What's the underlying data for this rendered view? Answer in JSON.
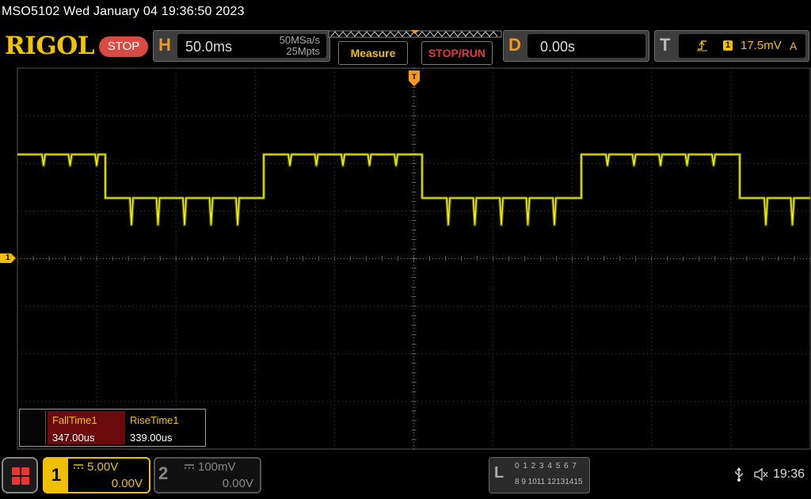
{
  "window": {
    "title": "MSO5102  Wed January 04 19:36:50 2023"
  },
  "header": {
    "logo": "RIGOL",
    "run_state": "STOP",
    "horizontal": {
      "letter": "H",
      "timebase": "50.0ms",
      "sample_rate": "50MSa/s",
      "memory_depth": "25Mpts"
    },
    "measure_label": "Measure",
    "stop_run_label": "STOP/RUN",
    "delay": {
      "letter": "D",
      "value": "0.00s"
    },
    "trigger": {
      "letter": "T",
      "edge_icon": "rising-edge-icon",
      "source": "1",
      "level": "17.5mV",
      "mode": "A"
    }
  },
  "measurements": [
    {
      "label": "FallTime1",
      "value": "347.00us"
    },
    {
      "label": "RiseTime1",
      "value": "339.00us"
    }
  ],
  "channel_marker": "1",
  "channels": [
    {
      "number": "1",
      "coupling_icon": "dc-coupling-icon",
      "scale": "5.00V",
      "offset": "0.00V",
      "color": "#f0c000",
      "active": true
    },
    {
      "number": "2",
      "coupling_icon": "dc-coupling-icon",
      "scale": "100mV",
      "offset": "0.00V",
      "color": "#888888",
      "active": false
    }
  ],
  "logic_analyzer": {
    "letter": "L",
    "row1": "0 1 2 3  4 5 6 7",
    "row2": "8  9 1011 12131415"
  },
  "status": {
    "time": "19:36"
  },
  "waveform": {
    "color": "#f0f000",
    "grid": {
      "horizontal_divisions": 10,
      "vertical_divisions": 8
    },
    "time_per_division": "50.0ms",
    "volts_per_division": "5.00V"
  }
}
